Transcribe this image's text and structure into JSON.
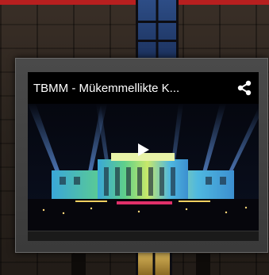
{
  "video": {
    "title": "TBMM - Mükemmellikte K..."
  },
  "icons": {
    "share": "share-icon",
    "play": "play-icon"
  },
  "colors": {
    "accent_red": "#b81f1f",
    "frame_gray": "#444444",
    "player_black": "#000000"
  }
}
